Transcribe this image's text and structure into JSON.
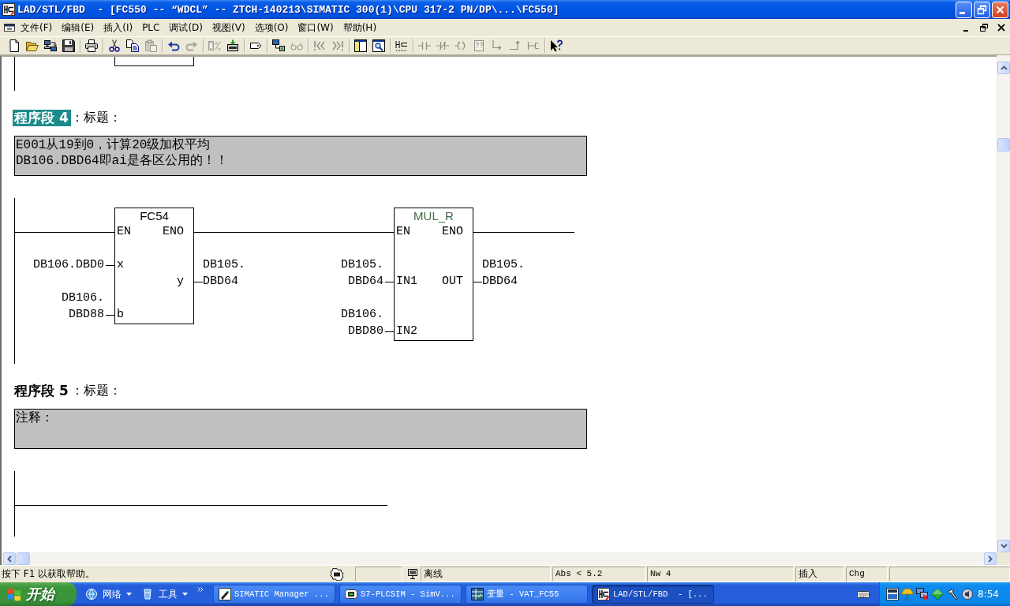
{
  "window": {
    "title": "LAD/STL/FBD  - [FC550 -- “WDCL” -- ZTCH-140213\\SIMATIC 300(1)\\CPU 317-2 PN/DP\\...\\FC550]"
  },
  "menu": [
    "文件(F)",
    "编辑(E)",
    "插入(I)",
    "PLC",
    "调试(D)",
    "视图(V)",
    "选项(O)",
    "窗口(W)",
    "帮助(H)"
  ],
  "toolbar": [
    [
      {
        "kind": "new",
        "disabled": false
      },
      {
        "kind": "open",
        "disabled": false
      },
      {
        "kind": "nodes",
        "disabled": false
      },
      {
        "kind": "save",
        "disabled": false
      }
    ],
    [
      {
        "kind": "print",
        "disabled": false
      }
    ],
    [
      {
        "kind": "cut",
        "disabled": false
      },
      {
        "kind": "copy",
        "disabled": false
      },
      {
        "kind": "paste",
        "disabled": true
      }
    ],
    [
      {
        "kind": "undo",
        "disabled": false
      },
      {
        "kind": "redo",
        "disabled": true
      }
    ],
    [
      {
        "kind": "blocks",
        "disabled": true
      },
      {
        "kind": "download",
        "disabled": false
      }
    ],
    [
      {
        "kind": "tag",
        "disabled": false
      }
    ],
    [
      {
        "kind": "network",
        "disabled": false
      },
      {
        "kind": "glasses",
        "disabled": true
      }
    ],
    [
      {
        "kind": "first",
        "disabled": true
      },
      {
        "kind": "last",
        "disabled": true
      }
    ],
    [
      {
        "kind": "panes",
        "disabled": false
      },
      {
        "kind": "zoomwin",
        "disabled": false
      }
    ],
    [
      {
        "kind": "rung",
        "disabled": false
      }
    ],
    [
      {
        "kind": "contact",
        "disabled": true
      },
      {
        "kind": "nc",
        "disabled": true
      },
      {
        "kind": "coil",
        "disabled": true
      },
      {
        "kind": "fbox",
        "disabled": true
      },
      {
        "kind": "branchopen",
        "disabled": true
      },
      {
        "kind": "branchclose",
        "disabled": true
      },
      {
        "kind": "connection",
        "disabled": true
      }
    ],
    [
      {
        "kind": "help",
        "disabled": false
      }
    ]
  ],
  "editor": {
    "networks": [
      {
        "heading": "程序段 4",
        "title": "：标题：",
        "selected": true,
        "comment": [
          "E001从19到0，计算20级加权平均",
          "DB106.DBD64即ai是各区公用的！！"
        ],
        "blocks": [
          {
            "title": "FC54",
            "kind": "call",
            "inputs": [
              {
                "pin": "EN"
              },
              {
                "pin": "x",
                "operand": [
                  "DB106.DBD0"
                ]
              },
              {
                "pin": "b",
                "operand": [
                  "DB106.",
                  "DBD88"
                ]
              }
            ],
            "outputs": [
              {
                "pin": "ENO"
              },
              {
                "pin": "y",
                "operand": [
                  "DB105.",
                  "DBD64"
                ]
              }
            ]
          },
          {
            "title": "MUL_R",
            "kind": "instruction",
            "inputs": [
              {
                "pin": "EN"
              },
              {
                "pin": "IN1",
                "operand": [
                  "DB105.",
                  "DBD64"
                ]
              },
              {
                "pin": "IN2",
                "operand": [
                  "DB106.",
                  "DBD80"
                ]
              }
            ],
            "outputs": [
              {
                "pin": "ENO"
              },
              {
                "pin": "OUT",
                "operand": [
                  "DB105.",
                  "DBD64"
                ]
              }
            ]
          }
        ]
      },
      {
        "heading": "程序段 5",
        "title": "：标题：",
        "selected": false,
        "comment": [
          "注释："
        ]
      }
    ]
  },
  "status_bar": {
    "help": "按下 F1 以获取帮助。",
    "mode": "离线",
    "address": "Abs < 5.2",
    "network": "Nw 4",
    "input_mode": "插入",
    "edit_mode": "Chg"
  },
  "taskbar": {
    "start": "开始",
    "toolbars": [
      "网络",
      "工具"
    ],
    "tasks": [
      {
        "label": "SIMATIC Manager ...",
        "selected": false
      },
      {
        "label": "S7-PLCSIM - SimV...",
        "selected": false
      },
      {
        "label": "变量 - VAT_FC55",
        "selected": false
      },
      {
        "label": "LAD/STL/FBD  - [...",
        "selected": true
      }
    ],
    "clock": "8:54"
  }
}
